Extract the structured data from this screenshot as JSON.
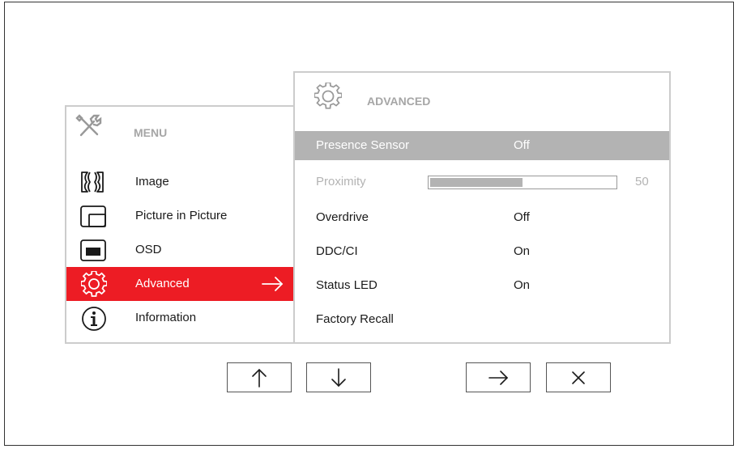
{
  "menu": {
    "title": "MENU",
    "items": [
      {
        "label": "Image",
        "icon": "image-icon",
        "selected": false
      },
      {
        "label": "Picture in Picture",
        "icon": "picture-in-picture-icon",
        "selected": false
      },
      {
        "label": "OSD",
        "icon": "osd-icon",
        "selected": false
      },
      {
        "label": "Advanced",
        "icon": "gear-icon",
        "selected": true
      },
      {
        "label": "Information",
        "icon": "info-icon",
        "selected": false
      }
    ]
  },
  "advanced": {
    "title": "ADVANCED",
    "rows": [
      {
        "label": "Presence Sensor",
        "value": "Off",
        "state": "highlighted"
      },
      {
        "label": "Proximity",
        "value": "50",
        "state": "disabled"
      },
      {
        "label": "Overdrive",
        "value": "Off",
        "state": "normal"
      },
      {
        "label": "DDC/CI",
        "value": "On",
        "state": "normal"
      },
      {
        "label": "Status LED",
        "value": "On",
        "state": "normal"
      },
      {
        "label": "Factory Recall",
        "value": "",
        "state": "normal"
      }
    ],
    "proximity_level_percent": 50
  },
  "nav_buttons": [
    "arrow-up-icon",
    "arrow-down-icon",
    "arrow-right-icon",
    "close-icon"
  ],
  "colors": {
    "accent": "#ed1c24",
    "highlight": "#b3b3b3",
    "border": "#cccccc",
    "muted_text": "#a6a6a6"
  }
}
